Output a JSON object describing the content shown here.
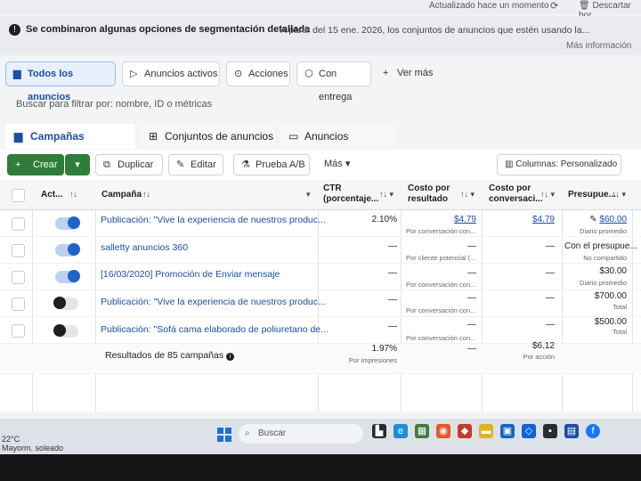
{
  "topbar": {
    "updated": "Actualizado hace un momento",
    "discard": "Descartar bor"
  },
  "notice": {
    "title": "Se combinaron algunas opciones de segmentación detallada",
    "body": "A partir del 15 ene. 2026, los conjuntos de anuncios que estén usando la...",
    "more": "Más información"
  },
  "filter_tabs": [
    {
      "label": "Todos los anuncios",
      "icon": "folder-icon"
    },
    {
      "label": "Anuncios activos",
      "icon": "play-icon"
    },
    {
      "label": "Acciones",
      "icon": "action-icon"
    },
    {
      "label": "Con entrega",
      "icon": "delivery-icon"
    },
    {
      "label": "Ver más",
      "icon": "plus-icon"
    }
  ],
  "search": {
    "placeholder": "Buscar para filtrar por: nombre, ID o métricas"
  },
  "level_tabs": [
    {
      "label": "Campañas",
      "icon": "folder-icon"
    },
    {
      "label": "Conjuntos de anuncios",
      "icon": "grid-icon"
    },
    {
      "label": "Anuncios",
      "icon": "ad-icon"
    }
  ],
  "toolbar": {
    "create": "Crear",
    "duplicate": "Duplicar",
    "edit": "Editar",
    "ab_test": "Prueba A/B",
    "more": "Más",
    "columns": "Columnas: Personalizado"
  },
  "table": {
    "headers": {
      "active": "Act...",
      "campaign": "Campaña",
      "ctr": "CTR (porcentaje...",
      "cost_result": "Costo por resultado",
      "cost_conv": "Costo por conversaci...",
      "budget": "Presupue..."
    },
    "rows": [
      {
        "name": "Publicación: \"Vive la experiencia de nuestros produc...",
        "active": true,
        "ctr": "2.10%",
        "cost_result": "$4.79",
        "cost_result_sub": "Por conversación con...",
        "cost_conv": "$4.79",
        "budget": "$60.00",
        "budget_sub": "Diario promedio"
      },
      {
        "name": "salletty anuncios 360",
        "active": true,
        "ctr": "—",
        "cost_result": "—",
        "cost_result_sub": "Por cliente potencial (...",
        "cost_conv": "—",
        "budget": "Con el presupue...",
        "budget_sub": "No compartido"
      },
      {
        "name": "[16/03/2020] Promoción de Enviar mensaje",
        "active": true,
        "ctr": "—",
        "cost_result": "—",
        "cost_result_sub": "Por conversación con...",
        "cost_conv": "—",
        "budget": "$30.00",
        "budget_sub": "Diario promedio"
      },
      {
        "name": "Publicación: \"Vive la experiencia de nuestros produc...",
        "active": false,
        "ctr": "—",
        "cost_result": "—",
        "cost_result_sub": "Por conversación con...",
        "cost_conv": "—",
        "budget": "$700.00",
        "budget_sub": "Total"
      },
      {
        "name": "Publicación: \"Sofá cama elaborado de poliuretano de...",
        "active": false,
        "ctr": "—",
        "cost_result": "—",
        "cost_result_sub": "Por conversación con...",
        "cost_conv": "—",
        "budget": "$500.00",
        "budget_sub": "Total"
      }
    ],
    "summary": {
      "label": "Resultados de 85 campañas",
      "ctr": "1.97%",
      "ctr_sub": "Por impresiones",
      "cost_result": "—",
      "cost_conv": "$6.12",
      "cost_conv_sub": "Por acción"
    }
  },
  "taskbar": {
    "temp": "22°C",
    "weather": "Mayorm. soleado",
    "search": "Buscar"
  },
  "colors": {
    "accent": "#1a4fa3",
    "create": "#2f7d3a",
    "toggle_on": "#1f63c7"
  }
}
